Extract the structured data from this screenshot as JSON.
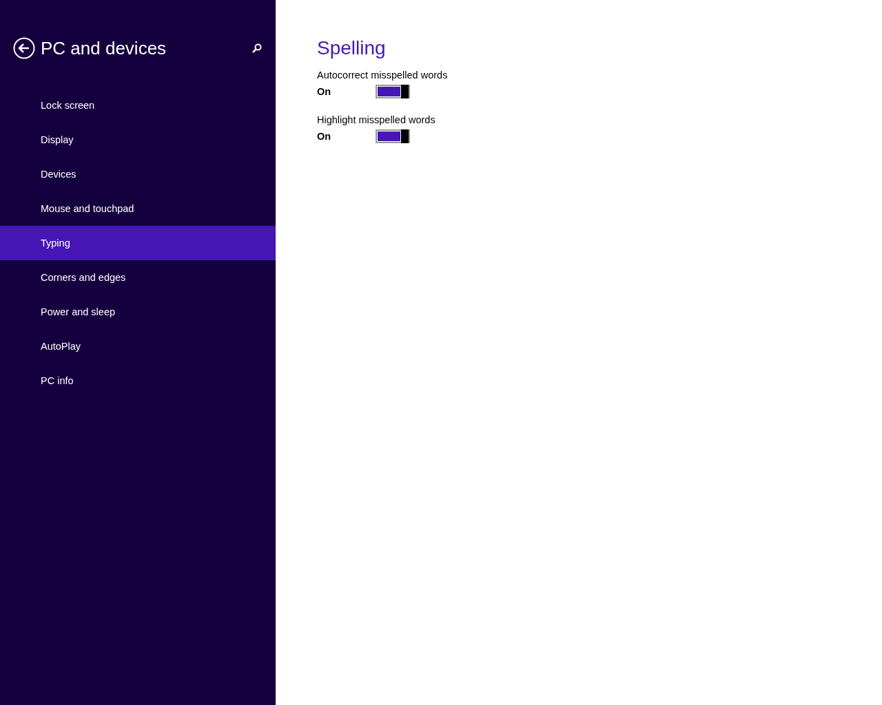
{
  "sidebar": {
    "title": "PC and devices",
    "items": [
      {
        "label": "Lock screen",
        "selected": false
      },
      {
        "label": "Display",
        "selected": false
      },
      {
        "label": "Devices",
        "selected": false
      },
      {
        "label": "Mouse and touchpad",
        "selected": false
      },
      {
        "label": "Typing",
        "selected": true
      },
      {
        "label": "Corners and edges",
        "selected": false
      },
      {
        "label": "Power and sleep",
        "selected": false
      },
      {
        "label": "AutoPlay",
        "selected": false
      },
      {
        "label": "PC info",
        "selected": false
      }
    ]
  },
  "content": {
    "heading": "Spelling",
    "settings": [
      {
        "label": "Autocorrect misspelled words",
        "state_text": "On",
        "on": true
      },
      {
        "label": "Highlight misspelled words",
        "state_text": "On",
        "on": true
      }
    ]
  }
}
